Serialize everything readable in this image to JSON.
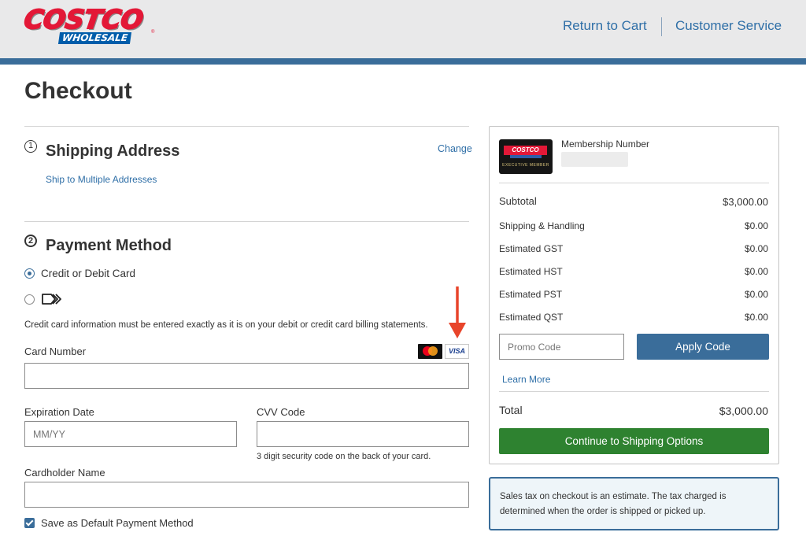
{
  "header": {
    "logo_top": "COSTCO",
    "logo_bottom": "WHOLESALE",
    "logo_reg": "®",
    "return_to_cart": "Return to Cart",
    "customer_service": "Customer Service"
  },
  "page": {
    "title": "Checkout"
  },
  "shipping": {
    "step_number": "1",
    "title": "Shipping Address",
    "change_link": "Change",
    "multi_link": "Ship to Multiple Addresses"
  },
  "payment": {
    "step_number": "2",
    "title": "Payment Method",
    "options": [
      {
        "label": "Credit or Debit Card",
        "selected": true
      },
      {
        "label": "",
        "icon": "alt-payment-icon",
        "selected": false
      }
    ],
    "info_text": "Credit card information must be entered exactly as it is on your debit or credit card billing statements.",
    "card_number_label": "Card Number",
    "accepted_cards": [
      "mastercard-icon",
      "visa-icon"
    ],
    "visa_text": "VISA",
    "card_number_value": "",
    "expiration_label": "Expiration Date",
    "expiration_placeholder": "MM/YY",
    "cvv_label": "CVV Code",
    "cvv_value": "",
    "cvv_hint": "3 digit security code on the back of your card.",
    "cardholder_label": "Cardholder Name",
    "cardholder_value": "",
    "save_default_label": "Save as Default Payment Method",
    "save_default_checked": true
  },
  "annotation": {
    "icon": "arrow-down-icon",
    "color": "#e8442a"
  },
  "summary": {
    "membership_label": "Membership Number",
    "membership_card_logo": "COSTCO",
    "membership_card_tier": "EXECUTIVE MEMBER",
    "subtotal_label": "Subtotal",
    "subtotal_value": "$3,000.00",
    "lines": [
      {
        "label": "Shipping & Handling",
        "value": "$0.00"
      },
      {
        "label": "Estimated GST",
        "value": "$0.00"
      },
      {
        "label": "Estimated HST",
        "value": "$0.00"
      },
      {
        "label": "Estimated PST",
        "value": "$0.00"
      },
      {
        "label": "Estimated QST",
        "value": "$0.00"
      }
    ],
    "promo_placeholder": "Promo Code",
    "apply_label": "Apply Code",
    "learn_more": "Learn More",
    "total_label": "Total",
    "total_value": "$3,000.00",
    "continue_label": "Continue to Shipping Options"
  },
  "tax_note": "Sales tax on checkout is an estimate. The tax charged is determined when the order is shipped or picked up.",
  "colors": {
    "brand_blue": "#3a6d9a",
    "link_blue": "#2f6fa7",
    "brand_red": "#e31837",
    "continue_green": "#2e8230"
  }
}
